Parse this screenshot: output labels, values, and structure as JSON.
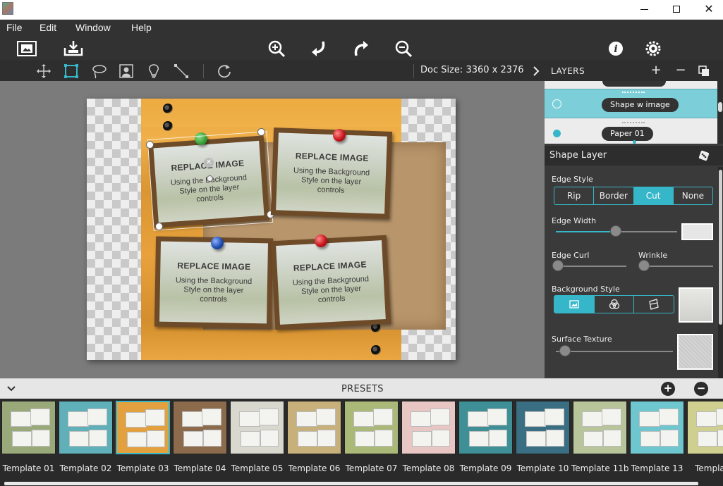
{
  "window": {
    "minimize_icon": "minimize-icon",
    "maximize_icon": "maximize-icon",
    "close_icon": "close-icon"
  },
  "menu": {
    "items": [
      "File",
      "Edit",
      "Window",
      "Help"
    ]
  },
  "toolbar": {
    "icons": [
      "open-image-icon",
      "save-icon",
      "zoom-in-icon",
      "undo-icon",
      "redo-icon",
      "zoom-out-icon",
      "info-icon",
      "settings-icon"
    ]
  },
  "tools": {
    "icons": [
      "move-icon",
      "rect-select-icon",
      "lasso-icon",
      "portrait-icon",
      "bulb-icon",
      "line-icon",
      "rotate-icon"
    ],
    "doc_size": "Doc Size: 3360 x 2376"
  },
  "canvas": {
    "photos": [
      {
        "title": "REPLACE IMAGE",
        "sub": "Using the Background Style on the layer controls"
      },
      {
        "title": "REPLACE IMAGE",
        "sub": "Using the Background Style on the layer controls"
      },
      {
        "title": "REPLACE IMAGE",
        "sub": "Using the Background Style on the layer controls"
      },
      {
        "title": "REPLACE IMAGE",
        "sub": "Using the Background Style on the layer controls"
      }
    ],
    "pin_colors": [
      "#3aa33a",
      "#c8161d",
      "#1f4fb0",
      "#c8161d"
    ]
  },
  "layers": {
    "title": "LAYERS",
    "add": "+",
    "remove": "−",
    "items": [
      {
        "name": "Shape w image",
        "selected": true
      },
      {
        "name": "Paper 01",
        "selected": false
      }
    ]
  },
  "shape_layer": {
    "title": "Shape Layer",
    "edge_style": {
      "label": "Edge Style",
      "options": [
        "Rip",
        "Border",
        "Cut",
        "None"
      ],
      "selected": "Cut"
    },
    "edge_width": {
      "label": "Edge Width",
      "value": 0.5
    },
    "edge_curl": {
      "label": "Edge Curl",
      "value": 0.0
    },
    "wrinkle": {
      "label": "Wrinkle",
      "value": 0.0
    },
    "background_style": {
      "label": "Background Style",
      "options": [
        "image-style-icon",
        "blend-icon",
        "pattern-icon"
      ],
      "selected": 0
    },
    "surface_texture": {
      "label": "Surface Texture",
      "value": 0.05
    },
    "accent_color": "#35b7c9"
  },
  "presets": {
    "title": "PRESETS",
    "add": "+",
    "remove": "−",
    "items": [
      {
        "name": "Template 01",
        "color": "#9aa97a",
        "selected": false
      },
      {
        "name": "Template 02",
        "color": "#5fb0b8",
        "selected": false
      },
      {
        "name": "Template 03",
        "color": "#e2a03f",
        "selected": true
      },
      {
        "name": "Template 04",
        "color": "#8b6b4b",
        "selected": false
      },
      {
        "name": "Template 05",
        "color": "#d8d8cf",
        "selected": false
      },
      {
        "name": "Template 06",
        "color": "#c8b07a",
        "selected": false
      },
      {
        "name": "Template 07",
        "color": "#aab878",
        "selected": false
      },
      {
        "name": "Template 08",
        "color": "#e7c6c4",
        "selected": false
      },
      {
        "name": "Template 09",
        "color": "#3e8f96",
        "selected": false
      },
      {
        "name": "Template 10",
        "color": "#3a6f83",
        "selected": false
      },
      {
        "name": "Template 11b",
        "color": "#b8c49a",
        "selected": false
      },
      {
        "name": "Template 13",
        "color": "#6ec7cf",
        "selected": false
      },
      {
        "name": "Template",
        "color": "#cfd08f",
        "selected": false
      }
    ]
  }
}
